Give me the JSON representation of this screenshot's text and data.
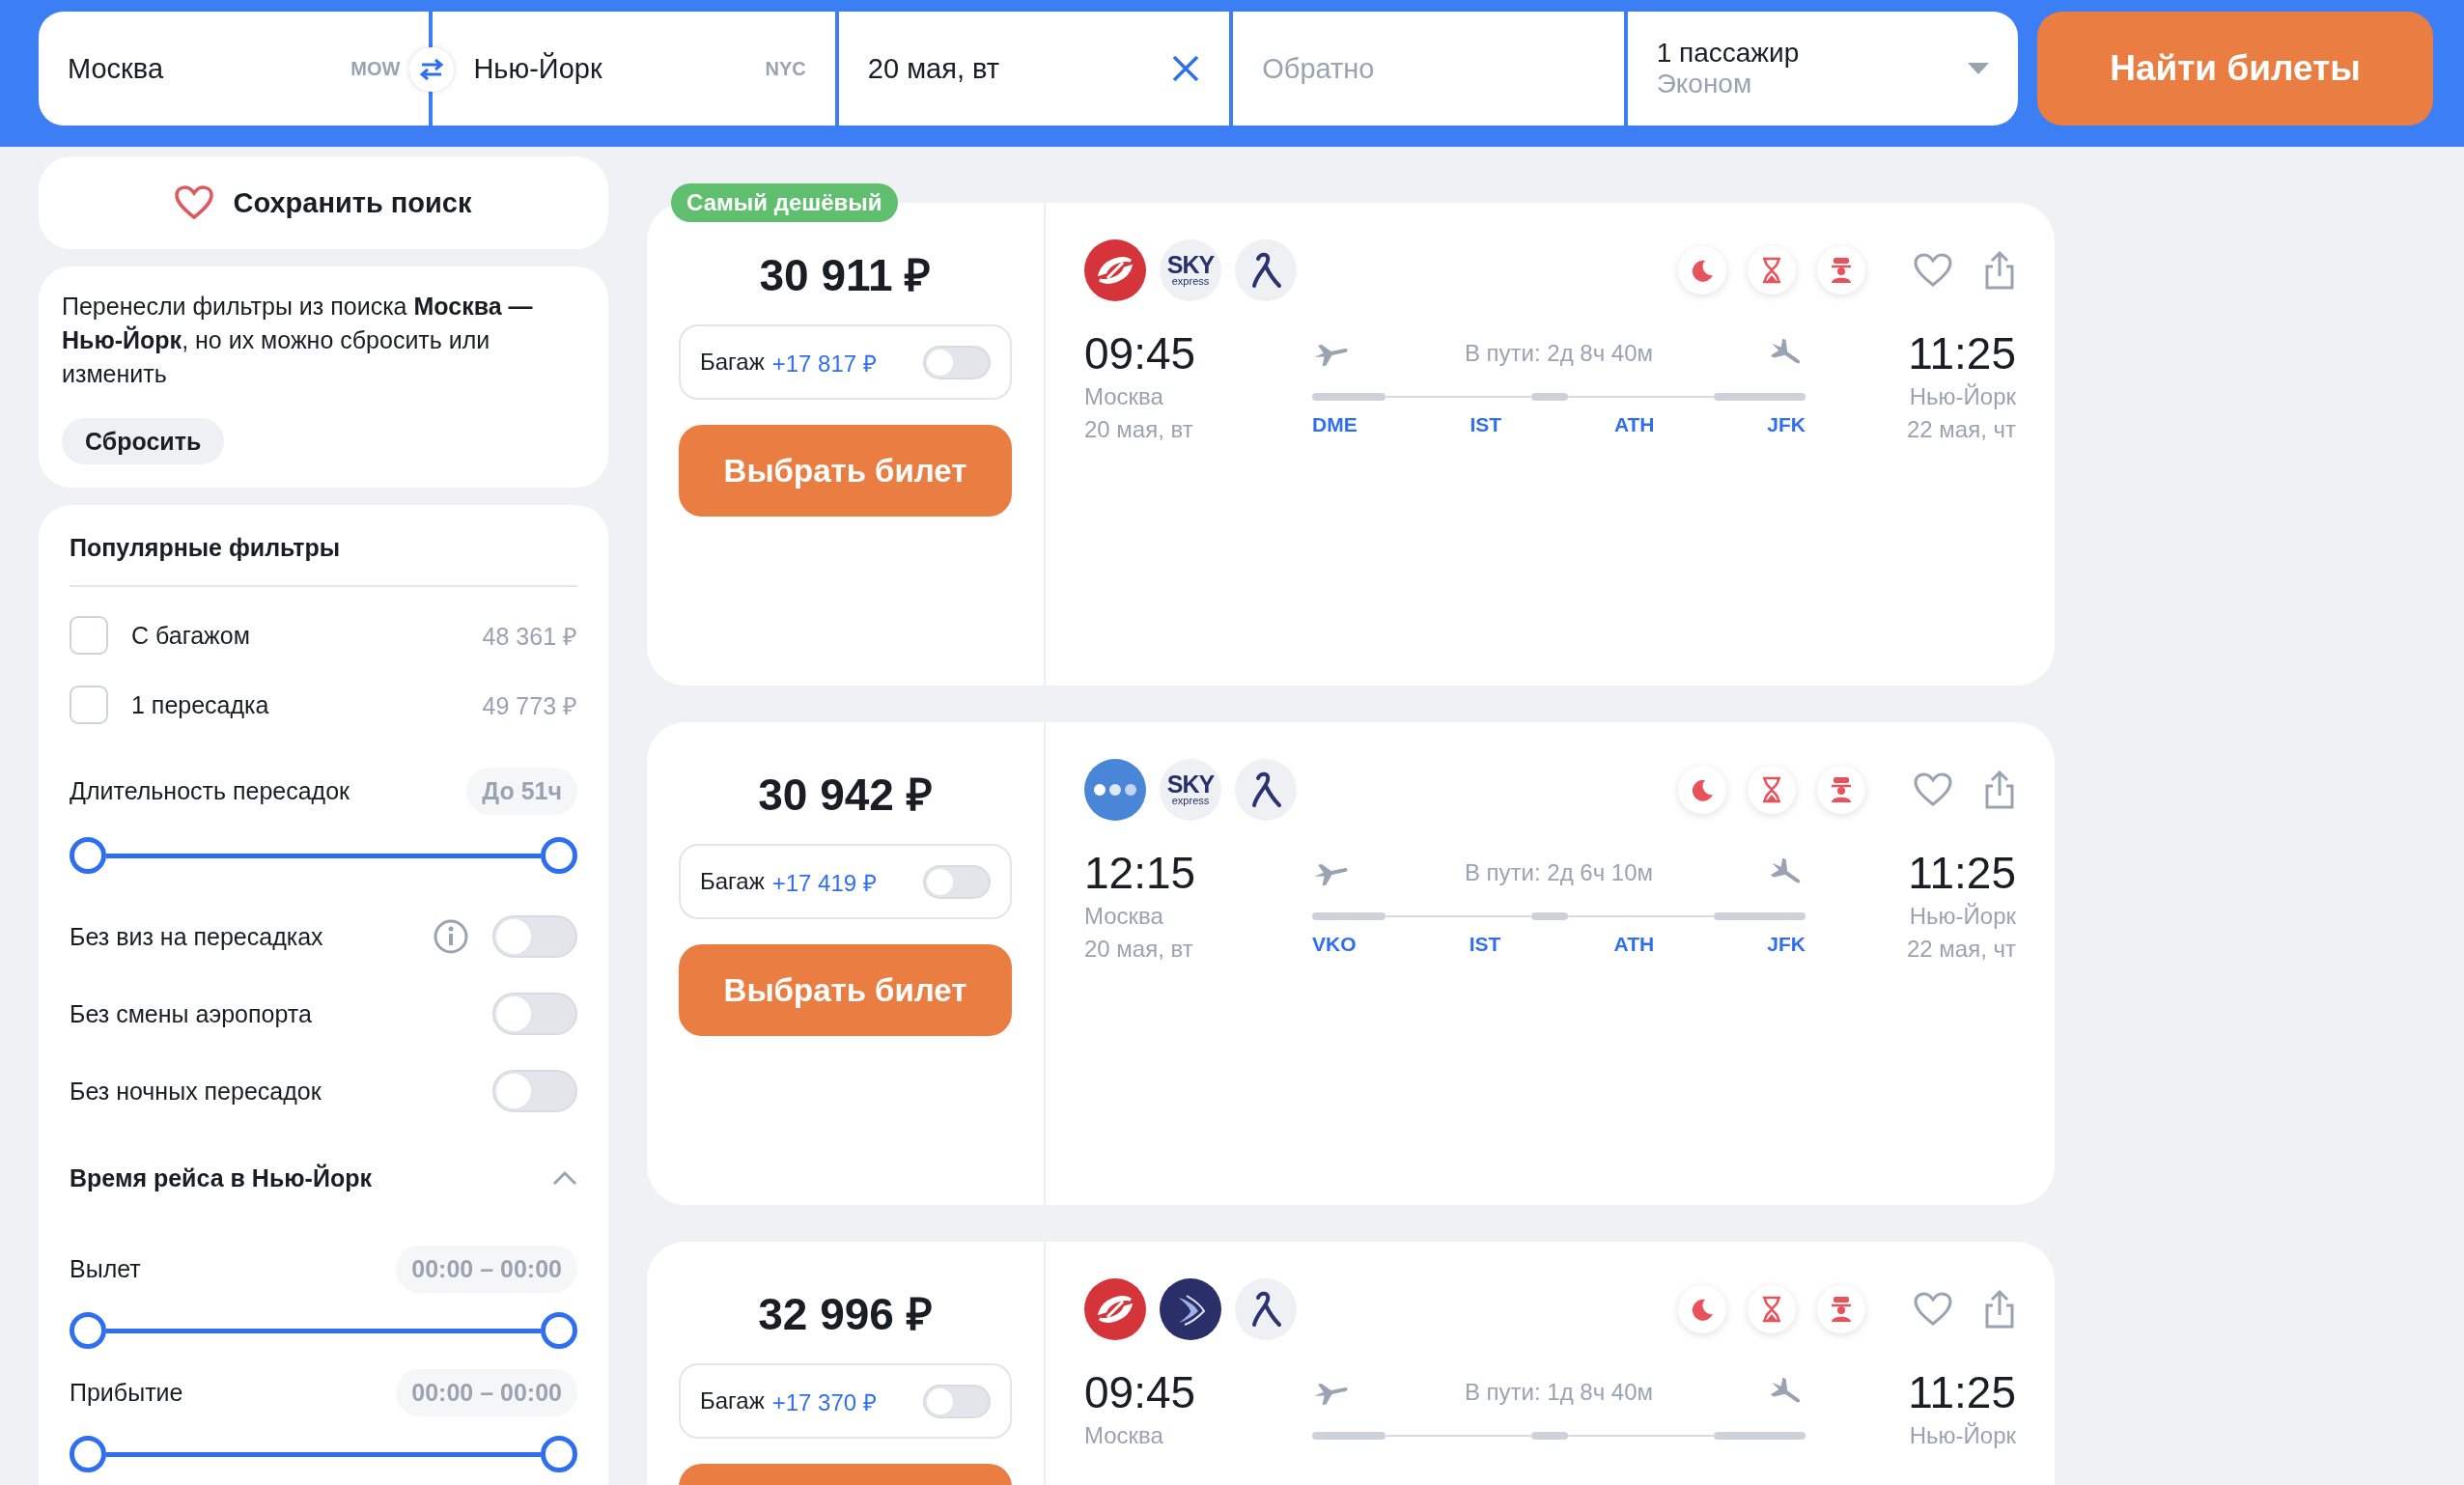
{
  "search": {
    "from": {
      "city": "Москва",
      "code": "MOW"
    },
    "to": {
      "city": "Нью-Йорк",
      "code": "NYC"
    },
    "date": "20 мая, вт",
    "return_placeholder": "Обратно",
    "passengers": "1 пассажир",
    "cabin": "Эконом",
    "button": "Найти билеты"
  },
  "sidebar": {
    "save_search": "Сохранить поиск",
    "notice": {
      "text": "Перенесли фильтры из поиска **Москва — Нью-Йорк**, но их можно сбросить или изменить",
      "button": "Сбросить"
    },
    "filters": {
      "title": "Популярные фильтры",
      "checks": [
        {
          "label": "С багажом",
          "price": "48 361 ₽",
          "checked": false
        },
        {
          "label": "1 пересадка",
          "price": "49 773 ₽",
          "checked": false
        }
      ],
      "layover": {
        "label": "Длительность пересадок",
        "value": "До 51ч",
        "level": 1
      },
      "toggles": [
        {
          "label": "Без виз на пересадках",
          "info": true,
          "on": false
        },
        {
          "label": "Без смены аэропорта",
          "info": false,
          "on": false
        },
        {
          "label": "Без ночных пересадок",
          "info": false,
          "on": false
        }
      ],
      "time_section": {
        "title": "Время рейса в Нью-Йорк",
        "expanded": true,
        "rows": [
          {
            "label": "Вылет",
            "value": "00:00 – 00:00",
            "level": 1
          },
          {
            "label": "Прибытие",
            "value": "00:00 – 00:00",
            "level": 1
          }
        ]
      }
    }
  },
  "tickets": [
    {
      "badge": "Самый дешёвый",
      "price": "30 911 ₽",
      "baggage": {
        "label": "Багаж",
        "price": "+17 817 ₽",
        "on": false
      },
      "button": {
        "kind": "labelled",
        "label": "Выбрать билет"
      },
      "airlines": [
        {
          "kind": "red"
        },
        {
          "kind": "sky",
          "text": "SKY",
          "subtext": "express"
        },
        {
          "kind": "swan"
        }
      ],
      "depart": {
        "time": "09:45",
        "city": "Москва",
        "date": "20 мая, вт"
      },
      "duration": "В пути: 2д 8ч 40м",
      "arrive": {
        "time": "11:25",
        "city": "Нью-Йорк",
        "date": "22 мая, чт"
      },
      "stops": [
        "DME",
        "IST",
        "ATH",
        "JFK"
      ]
    },
    {
      "price": "30 942 ₽",
      "baggage": {
        "label": "Багаж",
        "price": "+17 419 ₽",
        "on": false
      },
      "button": {
        "kind": "labelled",
        "label": "Выбрать билет"
      },
      "airlines": [
        {
          "kind": "dots"
        },
        {
          "kind": "sky",
          "text": "SKY",
          "subtext": "express"
        },
        {
          "kind": "swan"
        }
      ],
      "depart": {
        "time": "12:15",
        "city": "Москва",
        "date": "20 мая, вт"
      },
      "duration": "В пути: 2д 6ч 10м",
      "arrive": {
        "time": "11:25",
        "city": "Нью-Йорк",
        "date": "22 мая, чт"
      },
      "stops": [
        "VKO",
        "IST",
        "ATH",
        "JFK"
      ]
    },
    {
      "price": "32 996 ₽",
      "baggage": {
        "label": "Багаж",
        "price": "+17 370 ₽",
        "on": false
      },
      "button": {
        "kind": "blank"
      },
      "airlines": [
        {
          "kind": "red"
        },
        {
          "kind": "wing"
        },
        {
          "kind": "swan"
        }
      ],
      "depart": {
        "time": "09:45",
        "city": "Москва"
      },
      "duration": "В пути: 1д 8ч 40м",
      "arrive": {
        "time": "11:25",
        "city": "Нью-Йорк"
      }
    }
  ]
}
